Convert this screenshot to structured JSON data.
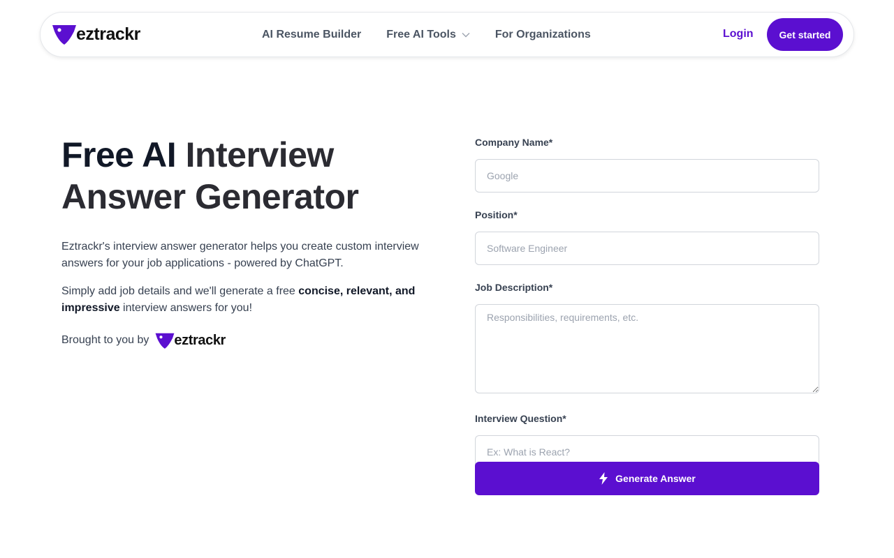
{
  "brand": {
    "name": "eztrackr",
    "color": "#5b0fd0"
  },
  "nav": {
    "links": [
      {
        "label": "AI Resume Builder"
      },
      {
        "label": "Free AI Tools",
        "has_dropdown": true
      },
      {
        "label": "For Organizations"
      }
    ],
    "login_label": "Login",
    "cta_label": "Get started"
  },
  "hero": {
    "title_lead": "Free AI",
    "title_rest": "Interview Answer Generator",
    "paragraph1": "Eztrackr's interview answer generator helps you create custom interview answers for your job applications - powered by ChatGPT.",
    "paragraph2_prefix": "Simply add job details and we'll generate a free ",
    "paragraph2_bold": "concise, relevant, and impressive",
    "paragraph2_suffix": " interview answers for you!",
    "brought_by": "Brought to you by"
  },
  "form": {
    "company": {
      "label": "Company Name*",
      "placeholder": "Google",
      "value": ""
    },
    "position": {
      "label": "Position*",
      "placeholder": "Software Engineer",
      "value": ""
    },
    "description": {
      "label": "Job Description*",
      "placeholder": "Responsibilities, requirements, etc.",
      "value": ""
    },
    "question": {
      "label": "Interview Question*",
      "placeholder": "Ex: What is React?",
      "value": ""
    },
    "submit_label": "Generate Answer"
  },
  "icons": {
    "logo": "eztrackr-logo-icon",
    "dropdown": "chevron-down-icon",
    "submit": "lightning-bolt-icon"
  }
}
